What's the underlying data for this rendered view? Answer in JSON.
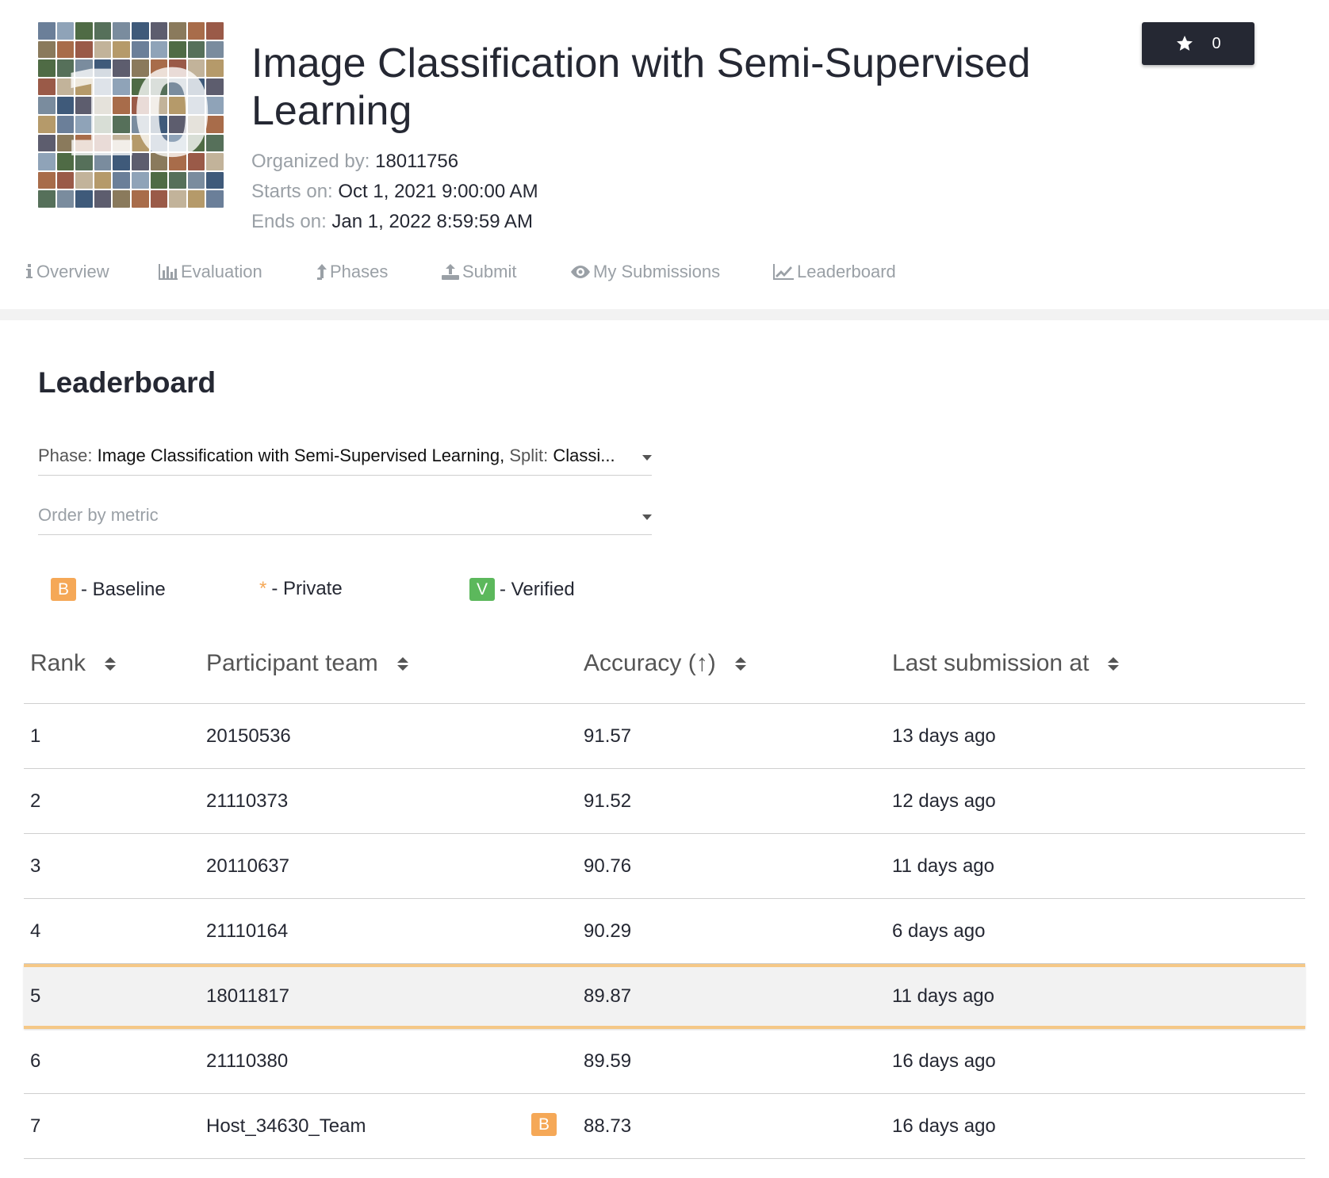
{
  "header": {
    "title": "Image Classification with Semi-Supervised Learning",
    "organized_by_label": "Organized by:",
    "organized_by": "18011756",
    "starts_label": "Starts on:",
    "starts": "Oct 1, 2021 9:00:00 AM",
    "ends_label": "Ends on:",
    "ends": "Jan 1, 2022 8:59:59 AM",
    "star_count": "0",
    "logo_text": "10"
  },
  "tabs": [
    {
      "label": "Overview",
      "icon": "info-icon"
    },
    {
      "label": "Evaluation",
      "icon": "bar-chart-icon"
    },
    {
      "label": "Phases",
      "icon": "arrow-up-icon"
    },
    {
      "label": "Submit",
      "icon": "upload-icon"
    },
    {
      "label": "My Submissions",
      "icon": "eye-icon"
    },
    {
      "label": "Leaderboard",
      "icon": "line-chart-icon"
    }
  ],
  "leaderboard": {
    "title": "Leaderboard",
    "phase_label": "Phase:",
    "phase_value": "Image Classification with Semi-Supervised Learning,",
    "split_label": "Split:",
    "split_value": "Classi...",
    "order_placeholder": "Order by metric",
    "legend": {
      "baseline_badge": "B",
      "baseline": "- Baseline",
      "private_mark": "*",
      "private": "- Private",
      "verified_badge": "V",
      "verified": "- Verified"
    },
    "columns": [
      "Rank",
      "Participant team",
      "Accuracy (↑)",
      "Last submission at"
    ],
    "rows": [
      {
        "rank": "1",
        "team": "20150536",
        "accuracy": "91.57",
        "last": "13 days ago"
      },
      {
        "rank": "2",
        "team": "21110373",
        "accuracy": "91.52",
        "last": "12 days ago"
      },
      {
        "rank": "3",
        "team": "20110637",
        "accuracy": "90.76",
        "last": "11 days ago"
      },
      {
        "rank": "4",
        "team": "21110164",
        "accuracy": "90.29",
        "last": "6 days ago"
      },
      {
        "rank": "5",
        "team": "18011817",
        "accuracy": "89.87",
        "last": "11 days ago"
      },
      {
        "rank": "6",
        "team": "21110380",
        "accuracy": "89.59",
        "last": "16 days ago"
      },
      {
        "rank": "7",
        "team": "Host_34630_Team",
        "accuracy": "88.73",
        "last": "16 days ago",
        "badge": "B"
      }
    ]
  },
  "colors": {
    "dark": "#252833",
    "muted": "#9aa0a6",
    "baseline": "#f5a857",
    "verified": "#5cb85c",
    "highlight_border": "#f5c887",
    "highlight_bg": "#f2f2f2"
  }
}
